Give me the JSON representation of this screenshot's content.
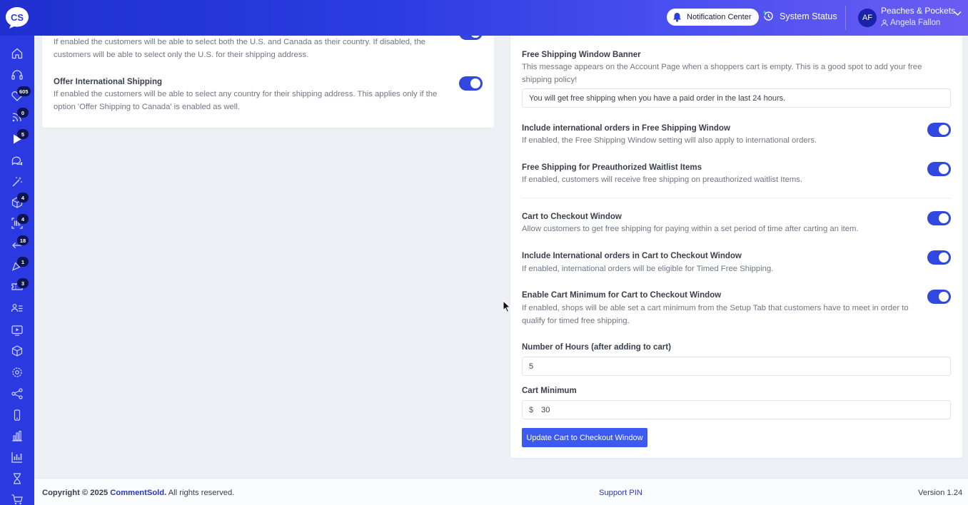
{
  "header": {
    "logo_text": "CS",
    "notification_label": "Notification Center",
    "system_status_label": "System Status",
    "avatar_initials": "AF",
    "shop_name": "Peaches & Pockets",
    "user_name": "Angela Fallon"
  },
  "sidebar": {
    "badges": {
      "live_shopping": "605",
      "feeds": "0",
      "video": "5",
      "products": "4",
      "scanner": "4",
      "returns": "18",
      "marketing": "1",
      "tickets": "3"
    }
  },
  "left_card": {
    "canada_desc": "If enabled the customers will be able to select both the U.S. and Canada as their country. If disabled, the customers will be able to select only the U.S. for their shipping address.",
    "intl_title": "Offer International Shipping",
    "intl_desc": "If enabled the customers will be able to select any country for their shipping address. This applies only if the option 'Offer Shipping to Canada' is enabled as well."
  },
  "right_card": {
    "banner_title": "Free Shipping Window Banner",
    "banner_desc": "This message appears on the Account Page when a shoppers cart is empty. This is a good spot to add your free shipping policy!",
    "banner_value": "You will get free shipping when you have a paid order in the last 24 hours.",
    "intl_fsw_title": "Include international orders in Free Shipping Window",
    "intl_fsw_desc": "If enabled, the Free Shipping Window setting will also apply to international orders.",
    "waitlist_title": "Free Shipping for Preauthorized Waitlist Items",
    "waitlist_desc": "If enabled, customers will receive free shipping on preauthorized waitlist Items.",
    "ctc_title": "Cart to Checkout Window",
    "ctc_desc": "Allow customers to get free shipping for paying within a set period of time after carting an item.",
    "intl_ctc_title": "Include International orders in Cart to Checkout Window",
    "intl_ctc_desc": "If enabled, international orders will be eligible for Timed Free Shipping.",
    "min_title": "Enable Cart Minimum for Cart to Checkout Window",
    "min_desc": "If enabled, shops will be able set a cart minimum from the Setup Tab that customers have to meet in order to qualify for timed free shipping.",
    "hours_label": "Number of Hours (after adding to cart)",
    "hours_value": "5",
    "cart_min_label": "Cart Minimum",
    "currency_symbol": "$",
    "cart_min_value": "30",
    "update_button": "Update Cart to Checkout Window"
  },
  "footer": {
    "copyright_prefix": "Copyright © 2025",
    "brand": "CommentSold.",
    "rights": "All rights reserved.",
    "support_pin": "Support PIN",
    "version": "Version 1.24"
  },
  "colors": {
    "primary": "#3048e0",
    "sidebar": "#2a3ae0",
    "brand_link": "#2a36c8"
  }
}
